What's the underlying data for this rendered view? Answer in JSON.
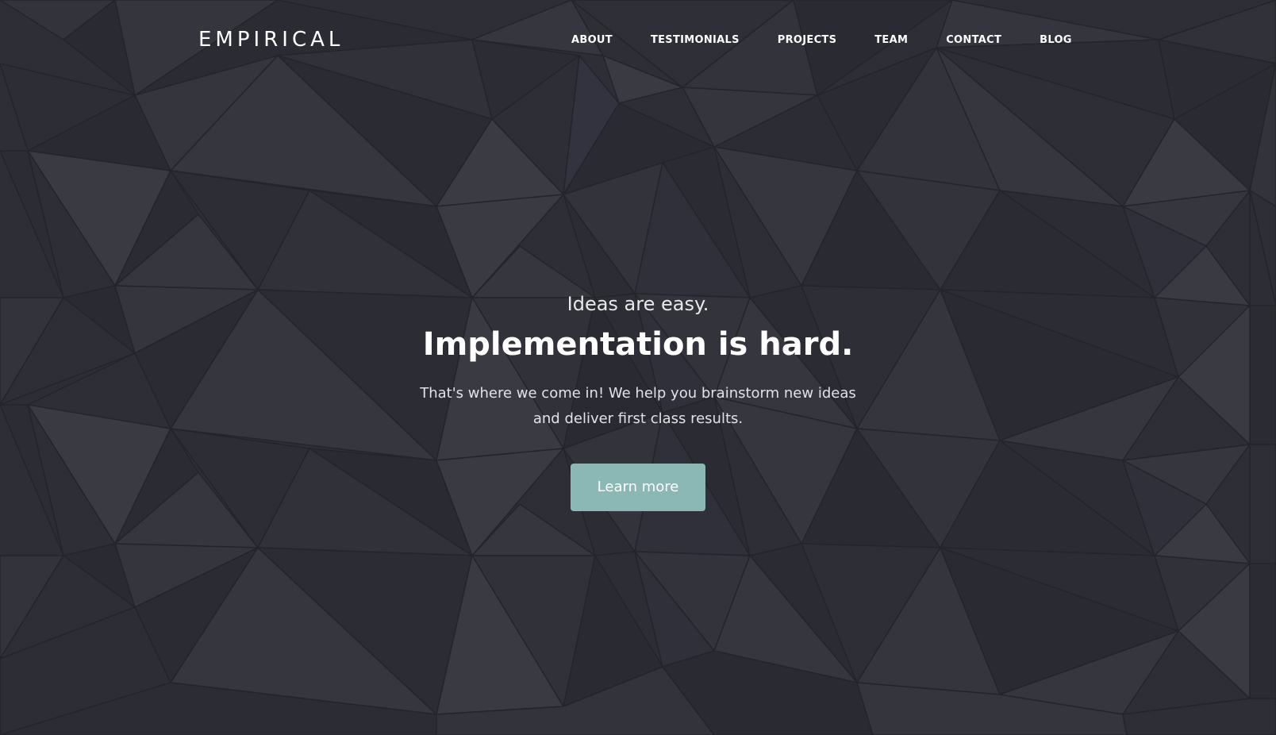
{
  "brand": {
    "logo_text": "EMPIRICAL"
  },
  "nav": {
    "items": [
      {
        "label": "ABOUT"
      },
      {
        "label": "TESTIMONIALS"
      },
      {
        "label": "PROJECTS"
      },
      {
        "label": "TEAM"
      },
      {
        "label": "CONTACT"
      },
      {
        "label": "BLOG"
      }
    ]
  },
  "hero": {
    "tagline": "Ideas are easy.",
    "headline": "Implementation is hard.",
    "lead": "That's where we come in! We help you brainstorm new ideas and deliver first class results.",
    "cta_label": "Learn more"
  },
  "colors": {
    "background": "#2e2e36",
    "accent": "#8bb8b4",
    "text": "#ffffff"
  }
}
